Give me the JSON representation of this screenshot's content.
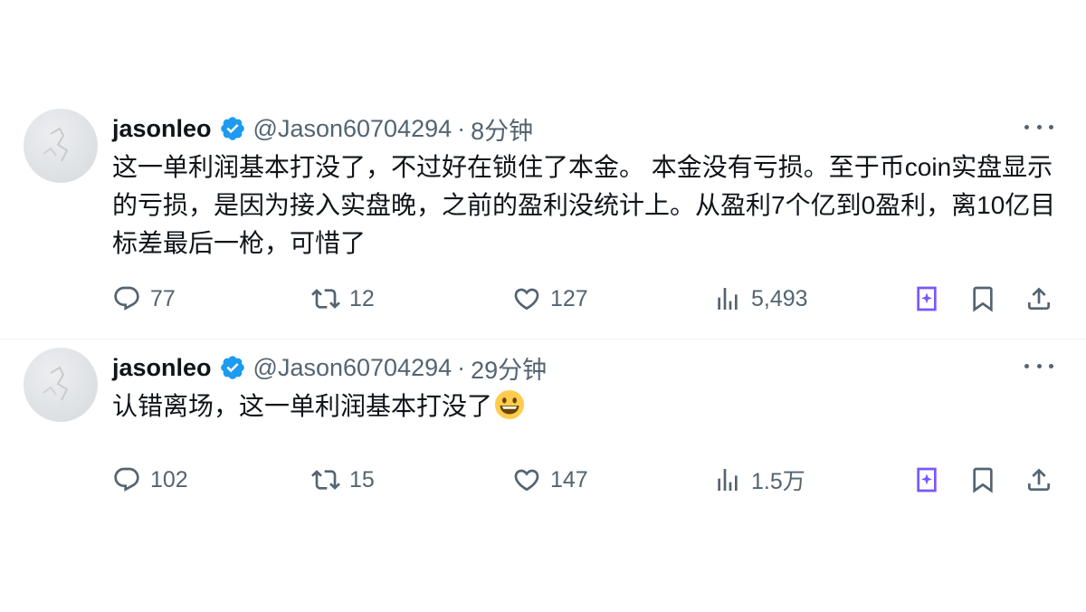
{
  "tweets": [
    {
      "author_name": "jasonleo",
      "handle": "@Jason60704294",
      "separator": "·",
      "time": "8分钟",
      "text": "这一单利润基本打没了，不过好在锁住了本金。 本金没有亏损。至于币coin实盘显示的亏损，是因为接入实盘晚，之前的盈利没统计上。从盈利7个亿到0盈利，离10亿目标差最后一枪，可惜了",
      "emoji": "",
      "replies": "77",
      "reposts": "12",
      "likes": "127",
      "views": "5,493"
    },
    {
      "author_name": "jasonleo",
      "handle": "@Jason60704294",
      "separator": "·",
      "time": "29分钟",
      "text": "认错离场，这一单利润基本打没了",
      "emoji": "grinning-face-emoji",
      "replies": "102",
      "reposts": "15",
      "likes": "147",
      "views": "1.5万"
    }
  ],
  "colors": {
    "text_primary": "#0f1419",
    "text_secondary": "#536471",
    "verified_blue": "#1d9bf0",
    "grok_purple": "#7856ff",
    "divider": "#eff3f4"
  },
  "icons": {
    "reply": "reply-icon",
    "repost": "repost-icon",
    "like": "heart-icon",
    "views": "views-icon",
    "grok": "grok-icon",
    "bookmark": "bookmark-icon",
    "share": "share-icon",
    "more": "more-icon",
    "verified": "verified-badge-icon"
  }
}
